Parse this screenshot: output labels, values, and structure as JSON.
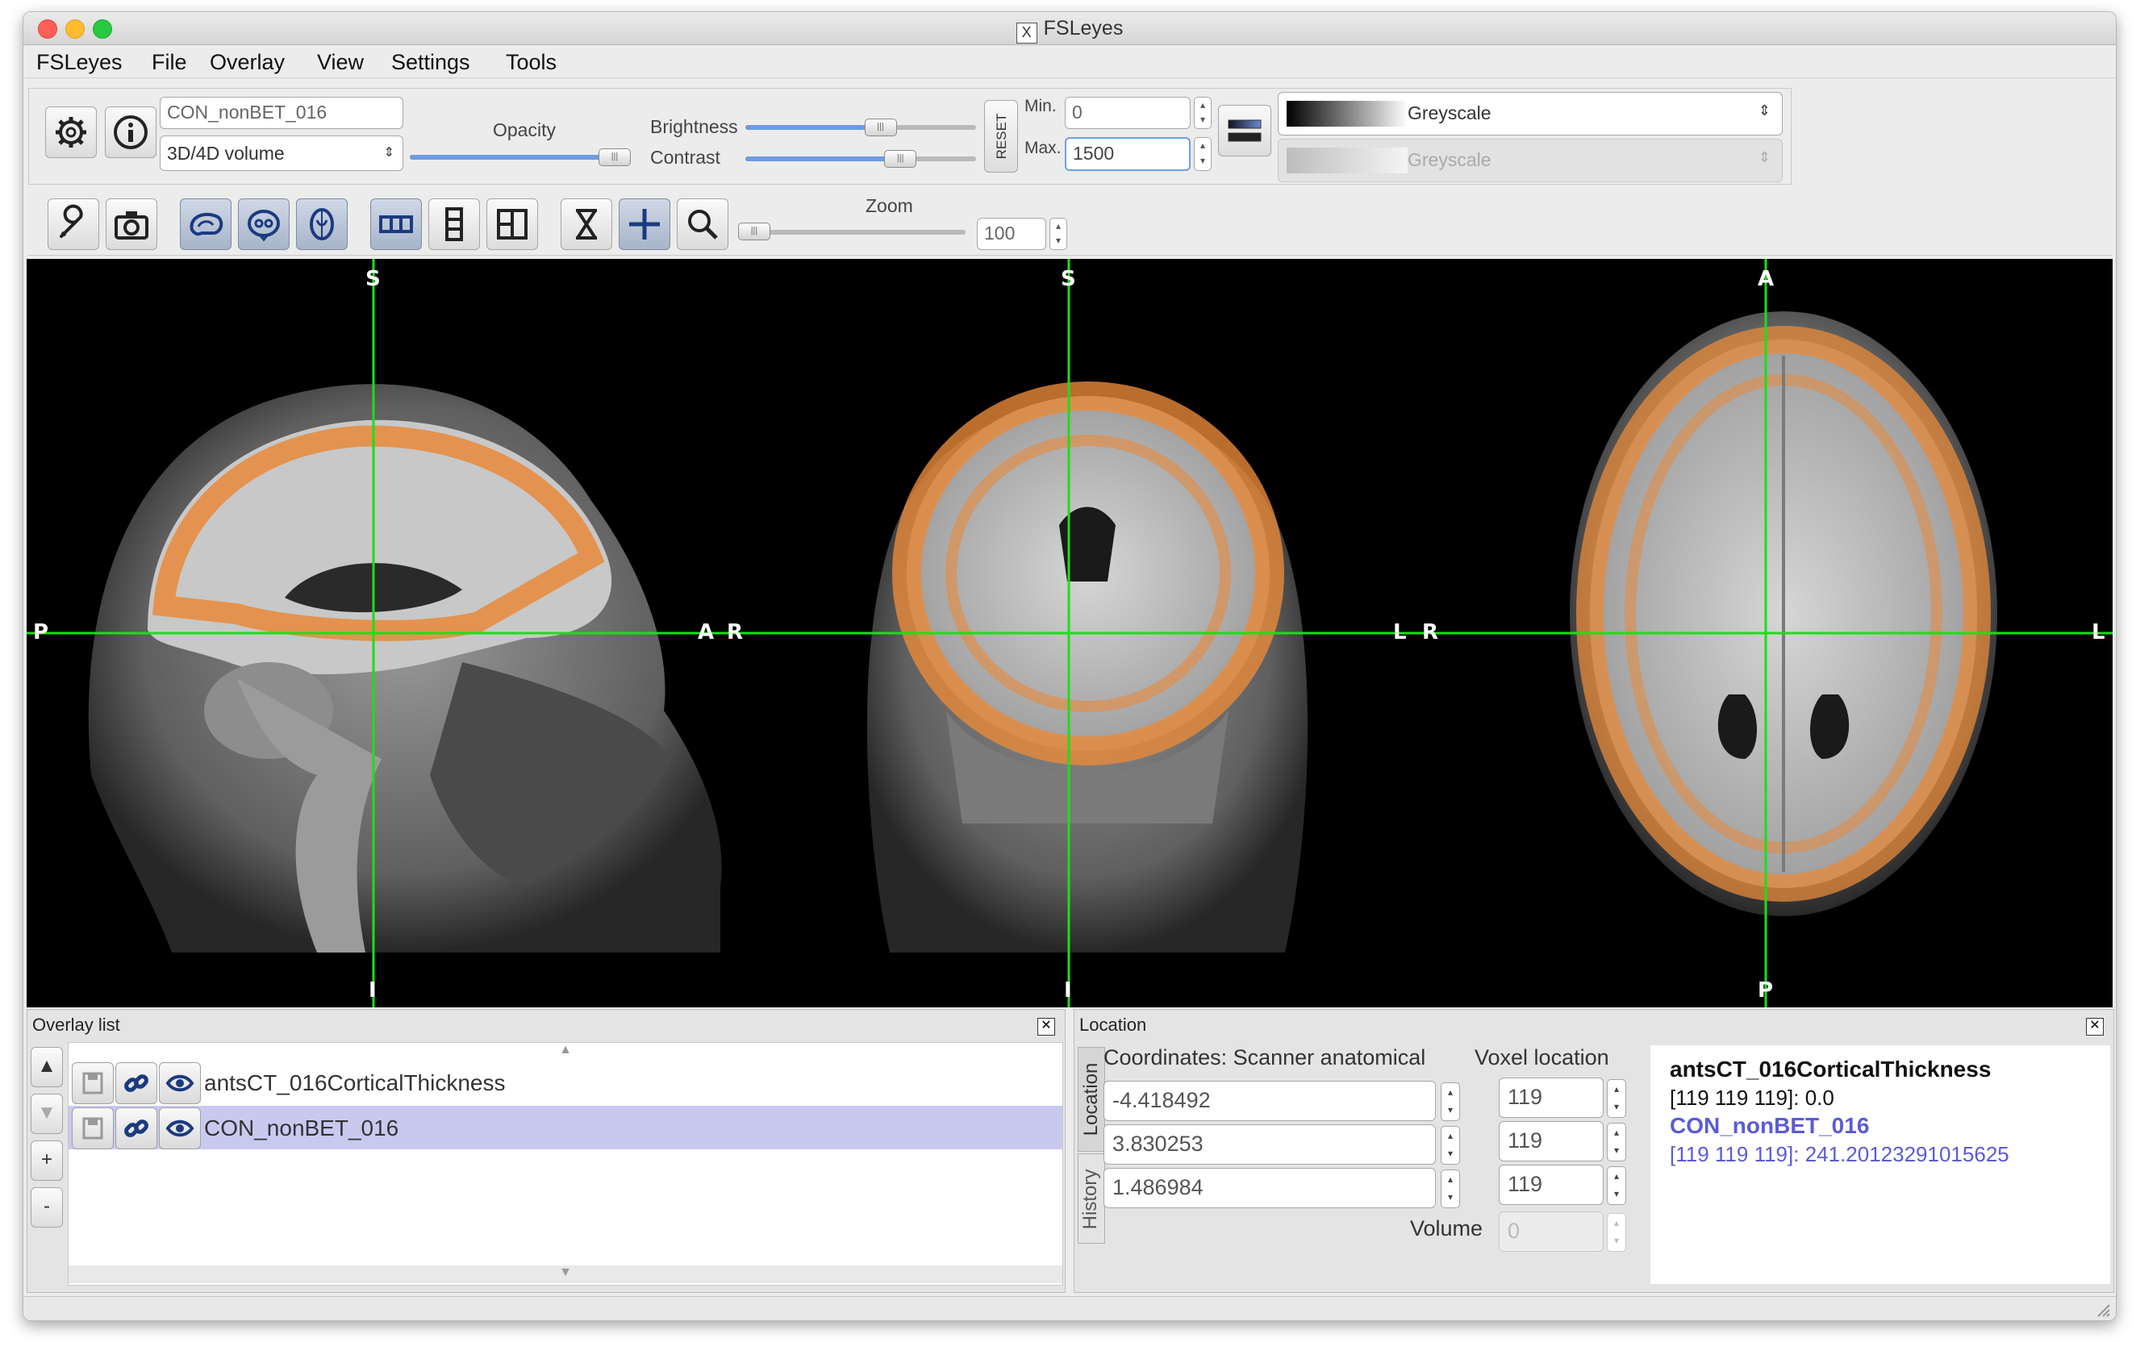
{
  "window": {
    "title": "FSLeyes",
    "traffic_light_colors": [
      "#fe5f57",
      "#febc2e",
      "#28c840"
    ]
  },
  "menu": [
    "FSLeyes",
    "File",
    "Overlay",
    "View",
    "Settings",
    "Tools"
  ],
  "overlay_toolbar": {
    "name_value": "CON_nonBET_016",
    "type_value": "3D/4D volume",
    "opacity_label": "Opacity",
    "opacity_level": 1.0,
    "brightness_label": "Brightness",
    "brightness_level": 0.6,
    "contrast_label": "Contrast",
    "contrast_level": 0.7,
    "reset_label": "RESET",
    "min_label": "Min.",
    "min_value": "0",
    "max_label": "Max.",
    "max_value": "1500",
    "cmap_value": "Greyscale",
    "neg_cmap_value": "Greyscale"
  },
  "view_toolbar": {
    "zoom_label": "Zoom",
    "zoom_value": "100",
    "zoom_level": 0.0
  },
  "viewer": {
    "sagittal": {
      "top": "S",
      "bottom": "I",
      "left": "P",
      "right": "A"
    },
    "coronal": {
      "top": "S",
      "bottom": "I",
      "left": "R",
      "right": "L"
    },
    "axial": {
      "top": "A",
      "bottom": "P",
      "left": "R",
      "right": "L"
    },
    "cursor_color": "#19e019",
    "overlay_color": "#e8893a"
  },
  "overlay_list": {
    "title": "Overlay list",
    "items": [
      {
        "name": "antsCT_016CorticalThickness",
        "selected": false
      },
      {
        "name": "CON_nonBET_016",
        "selected": true
      }
    ],
    "selected_color": "#c9c9f0"
  },
  "location": {
    "title": "Location",
    "tab_location": "Location",
    "tab_history": "History",
    "coords_label": "Coordinates: Scanner anatomical",
    "voxel_label": "Voxel location",
    "coords": [
      "-4.418492",
      "3.830253",
      "1.486984"
    ],
    "voxels": [
      "119",
      "119",
      "119"
    ],
    "volume_label": "Volume",
    "volume_value": "0",
    "info": {
      "overlay1_name": "antsCT_016CorticalThickness",
      "overlay1_value": "[119 119 119]: 0.0",
      "overlay2_name": "CON_nonBET_016",
      "overlay2_value": "[119 119 119]: 241.20123291015625",
      "highlight_color": "#5b5bd6"
    }
  }
}
